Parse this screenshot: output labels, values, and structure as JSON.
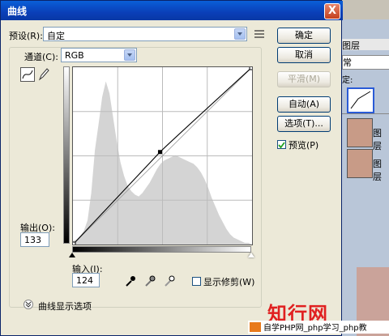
{
  "dialog": {
    "title": "曲线",
    "close": "X",
    "preset_label": "预设(R):",
    "preset_value": "自定",
    "channel_label": "通道(C):",
    "channel_value": "RGB",
    "output_label": "输出(O):",
    "output_value": "133",
    "input_label": "输入(I):",
    "input_value": "124",
    "show_clipping_label": "显示修剪(W)",
    "curve_display_options": "曲线显示选项"
  },
  "buttons": {
    "ok": "确定",
    "cancel": "取消",
    "smooth": "平滑(M)",
    "auto": "自动(A)",
    "options": "选项(T)...",
    "preview_label": "预览(P)",
    "preview_checked": true
  },
  "curve": {
    "point_input": 124,
    "point_output": 133,
    "histogram_color": "#d4d4d4",
    "histogram": [
      2,
      3,
      5,
      8,
      14,
      30,
      55,
      70,
      86,
      95,
      88,
      74,
      60,
      48,
      40,
      34,
      31,
      29,
      28,
      30,
      33,
      36,
      40,
      44,
      47,
      49,
      50,
      51,
      52,
      51,
      50,
      49,
      48,
      47,
      45,
      42,
      38,
      33,
      27,
      22,
      17,
      13,
      9,
      6,
      4,
      3,
      2,
      1,
      1,
      0
    ]
  },
  "side_panel": {
    "tab_layers": "图层",
    "mode": "常",
    "lock": "定:",
    "layer1": "图层",
    "layer2": "图层"
  },
  "watermark": {
    "brand": "知行网",
    "caption": "自学PHP网_php学习_php教"
  }
}
